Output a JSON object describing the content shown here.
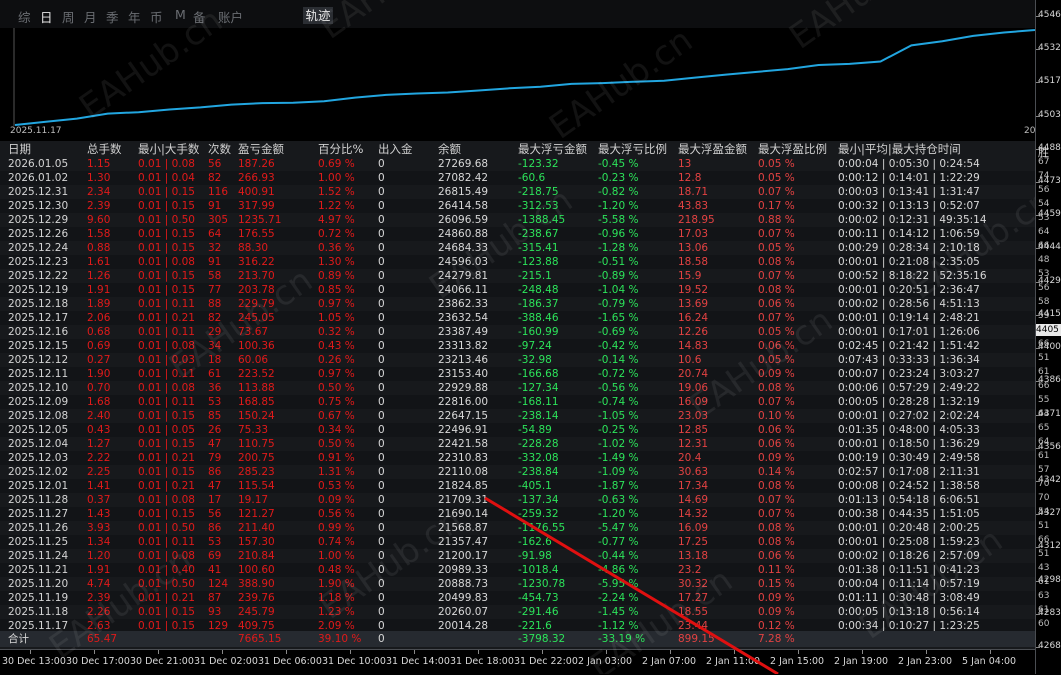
{
  "tabs": [
    {
      "label": "综",
      "active": false
    },
    {
      "label": "日",
      "active": true
    },
    {
      "label": "周",
      "active": false
    },
    {
      "label": "月",
      "active": false
    },
    {
      "label": "季",
      "active": false
    },
    {
      "label": "年",
      "active": false
    },
    {
      "label": "币",
      "active": false
    },
    {
      "label": "M",
      "active": false
    },
    {
      "label": "备",
      "active": false
    },
    {
      "label": "账户",
      "active": false
    }
  ],
  "trajectory_label": "轨迹",
  "chart": {
    "start_date": "2025.11.17",
    "end_date_partial": "20",
    "right_partial": "胜",
    "right_scale": [
      "4546",
      "4532",
      "4517",
      "4503",
      "4488",
      "4473",
      "4459",
      "4444",
      "4429",
      "4415",
      "4400",
      "4386",
      "4371",
      "4356",
      "4342",
      "4327",
      "4312",
      "4298",
      "4283",
      "4268"
    ],
    "current_price": "4405",
    "equity_values": [
      20014.28,
      20260.07,
      20499.83,
      20888.73,
      20989.33,
      21200.17,
      21357.47,
      21568.87,
      21690.14,
      21709.31,
      21824.85,
      22110.08,
      22310.83,
      22421.58,
      22496.91,
      22647.15,
      22816.0,
      22929.88,
      23153.4,
      23213.46,
      23313.82,
      23387.49,
      23632.54,
      23862.33,
      24066.11,
      24279.81,
      24596.03,
      24684.33,
      24860.88,
      26096.59,
      26414.58,
      26815.49,
      27082.42,
      27269.68
    ],
    "line_color": "#22a6e0"
  },
  "table": {
    "headers": [
      "日期",
      "总手数",
      "最小|大手数",
      "次数",
      "盈亏金额",
      "百分比%",
      "出入金",
      "余额",
      "最大浮亏金额",
      "最大浮亏比例",
      "最大浮盈金额",
      "最大浮盈比例",
      "最小|平均|最大持仓时间"
    ],
    "rows": [
      [
        "2026.01.05",
        "1.15",
        "0.01 | 0.08",
        "56",
        "187.26",
        "0.69 %",
        "0",
        "27269.68",
        "-123.32",
        "-0.45 %",
        "13",
        "0.05 %",
        "0:00:04 | 0:05:30 | 0:24:54"
      ],
      [
        "2026.01.02",
        "1.30",
        "0.01 | 0.04",
        "82",
        "266.93",
        "1.00 %",
        "0",
        "27082.42",
        "-60.6",
        "-0.23 %",
        "12.8",
        "0.05 %",
        "0:00:12 | 0:14:01 | 1:22:29"
      ],
      [
        "2025.12.31",
        "2.34",
        "0.01 | 0.15",
        "116",
        "400.91",
        "1.52 %",
        "0",
        "26815.49",
        "-218.75",
        "-0.82 %",
        "18.71",
        "0.07 %",
        "0:00:03 | 0:13:41 | 1:31:47"
      ],
      [
        "2025.12.30",
        "2.39",
        "0.01 | 0.15",
        "91",
        "317.99",
        "1.22 %",
        "0",
        "26414.58",
        "-312.53",
        "-1.20 %",
        "43.83",
        "0.17 %",
        "0:00:32 | 0:13:13 | 0:52:07"
      ],
      [
        "2025.12.29",
        "9.60",
        "0.01 | 0.50",
        "305",
        "1235.71",
        "4.97 %",
        "0",
        "26096.59",
        "-1388.45",
        "-5.58 %",
        "218.95",
        "0.88 %",
        "0:00:02 | 0:12:31 | 49:35:14"
      ],
      [
        "2025.12.26",
        "1.58",
        "0.01 | 0.15",
        "64",
        "176.55",
        "0.72 %",
        "0",
        "24860.88",
        "-238.67",
        "-0.96 %",
        "17.03",
        "0.07 %",
        "0:00:11 | 0:14:12 | 1:06:59"
      ],
      [
        "2025.12.24",
        "0.88",
        "0.01 | 0.15",
        "32",
        "88.30",
        "0.36 %",
        "0",
        "24684.33",
        "-315.41",
        "-1.28 %",
        "13.06",
        "0.05 %",
        "0:00:29 | 0:28:34 | 2:10:18"
      ],
      [
        "2025.12.23",
        "1.61",
        "0.01 | 0.08",
        "91",
        "316.22",
        "1.30 %",
        "0",
        "24596.03",
        "-123.88",
        "-0.51 %",
        "18.58",
        "0.08 %",
        "0:00:01 | 0:21:08 | 2:35:05"
      ],
      [
        "2025.12.22",
        "1.26",
        "0.01 | 0.15",
        "58",
        "213.70",
        "0.89 %",
        "0",
        "24279.81",
        "-215.1",
        "-0.89 %",
        "15.9",
        "0.07 %",
        "0:00:52 | 8:18:22 | 52:35:16"
      ],
      [
        "2025.12.19",
        "1.91",
        "0.01 | 0.15",
        "77",
        "203.78",
        "0.85 %",
        "0",
        "24066.11",
        "-248.48",
        "-1.04 %",
        "19.52",
        "0.08 %",
        "0:00:01 | 0:20:51 | 2:36:47"
      ],
      [
        "2025.12.18",
        "1.89",
        "0.01 | 0.11",
        "88",
        "229.79",
        "0.97 %",
        "0",
        "23862.33",
        "-186.37",
        "-0.79 %",
        "13.69",
        "0.06 %",
        "0:00:02 | 0:28:56 | 4:51:13"
      ],
      [
        "2025.12.17",
        "2.06",
        "0.01 | 0.21",
        "82",
        "245.05",
        "1.05 %",
        "0",
        "23632.54",
        "-388.46",
        "-1.65 %",
        "16.24",
        "0.07 %",
        "0:00:01 | 0:19:14 | 2:48:21"
      ],
      [
        "2025.12.16",
        "0.68",
        "0.01 | 0.11",
        "29",
        "73.67",
        "0.32 %",
        "0",
        "23387.49",
        "-160.99",
        "-0.69 %",
        "12.26",
        "0.05 %",
        "0:00:01 | 0:17:01 | 1:26:06"
      ],
      [
        "2025.12.15",
        "0.69",
        "0.01 | 0.08",
        "34",
        "100.36",
        "0.43 %",
        "0",
        "23313.82",
        "-97.24",
        "-0.42 %",
        "14.83",
        "0.06 %",
        "0:02:45 | 0:21:42 | 1:51:42"
      ],
      [
        "2025.12.12",
        "0.27",
        "0.01 | 0.03",
        "18",
        "60.06",
        "0.26 %",
        "0",
        "23213.46",
        "-32.98",
        "-0.14 %",
        "10.6",
        "0.05 %",
        "0:07:43 | 0:33:33 | 1:36:34"
      ],
      [
        "2025.12.11",
        "1.90",
        "0.01 | 0.11",
        "61",
        "223.52",
        "0.97 %",
        "0",
        "23153.40",
        "-166.68",
        "-0.72 %",
        "20.74",
        "0.09 %",
        "0:00:07 | 0:23:24 | 3:03:27"
      ],
      [
        "2025.12.10",
        "0.70",
        "0.01 | 0.08",
        "36",
        "113.88",
        "0.50 %",
        "0",
        "22929.88",
        "-127.34",
        "-0.56 %",
        "19.06",
        "0.08 %",
        "0:00:06 | 0:57:29 | 2:49:22"
      ],
      [
        "2025.12.09",
        "1.68",
        "0.01 | 0.11",
        "53",
        "168.85",
        "0.75 %",
        "0",
        "22816.00",
        "-168.11",
        "-0.74 %",
        "16.09",
        "0.07 %",
        "0:00:05 | 0:28:28 | 1:32:19"
      ],
      [
        "2025.12.08",
        "2.40",
        "0.01 | 0.15",
        "85",
        "150.24",
        "0.67 %",
        "0",
        "22647.15",
        "-238.14",
        "-1.05 %",
        "23.03",
        "0.10 %",
        "0:00:01 | 0:27:02 | 2:02:24"
      ],
      [
        "2025.12.05",
        "0.43",
        "0.01 | 0.05",
        "26",
        "75.33",
        "0.34 %",
        "0",
        "22496.91",
        "-54.89",
        "-0.25 %",
        "12.85",
        "0.06 %",
        "0:01:35 | 0:48:00 | 4:05:33"
      ],
      [
        "2025.12.04",
        "1.27",
        "0.01 | 0.15",
        "47",
        "110.75",
        "0.50 %",
        "0",
        "22421.58",
        "-228.28",
        "-1.02 %",
        "12.31",
        "0.06 %",
        "0:00:01 | 0:18:50 | 1:36:29"
      ],
      [
        "2025.12.03",
        "2.22",
        "0.01 | 0.21",
        "79",
        "200.75",
        "0.91 %",
        "0",
        "22310.83",
        "-332.08",
        "-1.49 %",
        "20.4",
        "0.09 %",
        "0:00:19 | 0:30:49 | 2:49:58"
      ],
      [
        "2025.12.02",
        "2.25",
        "0.01 | 0.15",
        "86",
        "285.23",
        "1.31 %",
        "0",
        "22110.08",
        "-238.84",
        "-1.09 %",
        "30.63",
        "0.14 %",
        "0:02:57 | 0:17:08 | 2:11:31"
      ],
      [
        "2025.12.01",
        "1.41",
        "0.01 | 0.21",
        "47",
        "115.54",
        "0.53 %",
        "0",
        "21824.85",
        "-405.1",
        "-1.87 %",
        "17.34",
        "0.08 %",
        "0:00:08 | 0:24:52 | 1:38:58"
      ],
      [
        "2025.11.28",
        "0.37",
        "0.01 | 0.08",
        "17",
        "19.17",
        "0.09 %",
        "0",
        "21709.31",
        "-137.34",
        "-0.63 %",
        "14.69",
        "0.07 %",
        "0:01:13 | 0:54:18 | 6:06:51"
      ],
      [
        "2025.11.27",
        "1.43",
        "0.01 | 0.15",
        "56",
        "121.27",
        "0.56 %",
        "0",
        "21690.14",
        "-259.32",
        "-1.20 %",
        "14.32",
        "0.07 %",
        "0:00:38 | 0:44:35 | 1:51:05"
      ],
      [
        "2025.11.26",
        "3.93",
        "0.01 | 0.50",
        "86",
        "211.40",
        "0.99 %",
        "0",
        "21568.87",
        "-1176.55",
        "-5.47 %",
        "16.09",
        "0.08 %",
        "0:00:01 | 0:20:48 | 2:00:25"
      ],
      [
        "2025.11.25",
        "1.34",
        "0.01 | 0.11",
        "53",
        "157.30",
        "0.74 %",
        "0",
        "21357.47",
        "-162.6",
        "-0.77 %",
        "17.25",
        "0.08 %",
        "0:00:01 | 0:25:08 | 1:59:23"
      ],
      [
        "2025.11.24",
        "1.20",
        "0.01 | 0.08",
        "69",
        "210.84",
        "1.00 %",
        "0",
        "21200.17",
        "-91.98",
        "-0.44 %",
        "13.18",
        "0.06 %",
        "0:00:02 | 0:18:26 | 2:57:09"
      ],
      [
        "2025.11.21",
        "1.91",
        "0.01 | 0.40",
        "41",
        "100.60",
        "0.48 %",
        "0",
        "20989.33",
        "-1018.4",
        "-4.86 %",
        "23.2",
        "0.11 %",
        "0:01:38 | 0:11:51 | 0:41:23"
      ],
      [
        "2025.11.20",
        "4.74",
        "0.01 | 0.50",
        "124",
        "388.90",
        "1.90 %",
        "0",
        "20888.73",
        "-1230.78",
        "-5.95 %",
        "30.32",
        "0.15 %",
        "0:00:04 | 0:11:14 | 0:57:19"
      ],
      [
        "2025.11.19",
        "2.39",
        "0.01 | 0.21",
        "87",
        "239.76",
        "1.18 %",
        "0",
        "20499.83",
        "-454.73",
        "-2.24 %",
        "17.27",
        "0.09 %",
        "0:01:11 | 0:30:48 | 3:08:49"
      ],
      [
        "2025.11.18",
        "2.26",
        "0.01 | 0.15",
        "93",
        "245.79",
        "1.23 %",
        "0",
        "20260.07",
        "-291.46",
        "-1.45 %",
        "18.55",
        "0.09 %",
        "0:00:05 | 0:13:18 | 0:56:14"
      ],
      [
        "2025.11.17",
        "2.63",
        "0.01 | 0.15",
        "129",
        "409.75",
        "2.09 %",
        "0",
        "20014.28",
        "-221.6",
        "-1.12 %",
        "23.44",
        "0.12 %",
        "0:00:34 | 0:10:27 | 1:23:25"
      ]
    ],
    "total": {
      "label": "合计",
      "lots": "65.47",
      "profit": "7665.15",
      "percent": "39.10 %",
      "deposit": "0",
      "max_dd": "-3798.32",
      "max_dd_pct": "-33.19 %",
      "max_fp": "899.15",
      "max_fp_pct": "7.28 %"
    }
  },
  "right_partial_values": [
    "67",
    "74",
    "56",
    "54",
    "53",
    "64",
    "66",
    "48",
    "53",
    "56",
    "58",
    "59",
    "58",
    "66",
    "51",
    "61",
    "66",
    "55",
    "64",
    "65",
    "64",
    "61",
    "57",
    "70",
    "70",
    "54",
    "51",
    "66",
    "51",
    "43",
    "61",
    "63",
    "61",
    "60"
  ],
  "x_axis": [
    "30 Dec 13:00",
    "30 Dec 17:00",
    "30 Dec 21:00",
    "31 Dec 02:00",
    "31 Dec 06:00",
    "31 Dec 10:00",
    "31 Dec 14:00",
    "31 Dec 18:00",
    "31 Dec 22:00",
    "2 Jan 03:00",
    "2 Jan 07:00",
    "2 Jan 11:00",
    "2 Jan 15:00",
    "2 Jan 19:00",
    "2 Jan 23:00",
    "5 Jan 04:00"
  ],
  "watermark": "EAHub.cn"
}
